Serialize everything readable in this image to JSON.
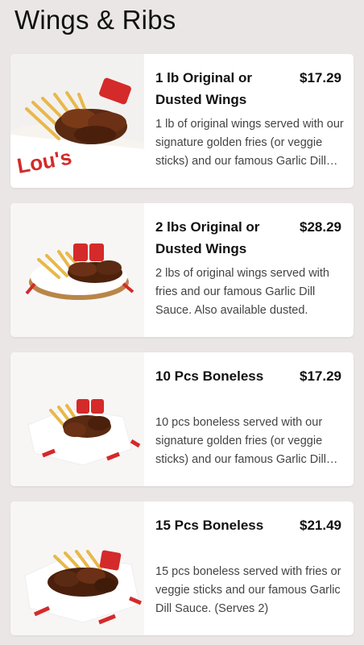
{
  "header": {
    "title": "Wings & Ribs"
  },
  "items": [
    {
      "name": "1 lb Original or Dusted Wings",
      "price": "$17.29",
      "description": "1 lb of original wings served with our signature golden fries (or veggie sticks) and our famous Garlic Dill Sauce."
    },
    {
      "name": "2 lbs Original or Dusted Wings",
      "price": "$28.29",
      "description": "2 lbs of original wings served with fries and our famous Garlic Dill Sauce. Also available dusted."
    },
    {
      "name": "10 Pcs Boneless",
      "price": "$17.29",
      "description": "10 pcs boneless served with our signature golden fries (or veggie sticks) and our famous Garlic Dill Sauce."
    },
    {
      "name": "15 Pcs Boneless",
      "price": "$21.49",
      "description": "15 pcs boneless served with fries or veggie sticks and our famous Garlic Dill Sauce. (Serves 2)"
    }
  ],
  "colors": {
    "background": "#ebe6e6",
    "card": "#ffffff",
    "text": "#111111",
    "description": "#444444",
    "brand_red": "#d42a2a"
  },
  "icons": [
    "food-photo-wings-basket"
  ]
}
